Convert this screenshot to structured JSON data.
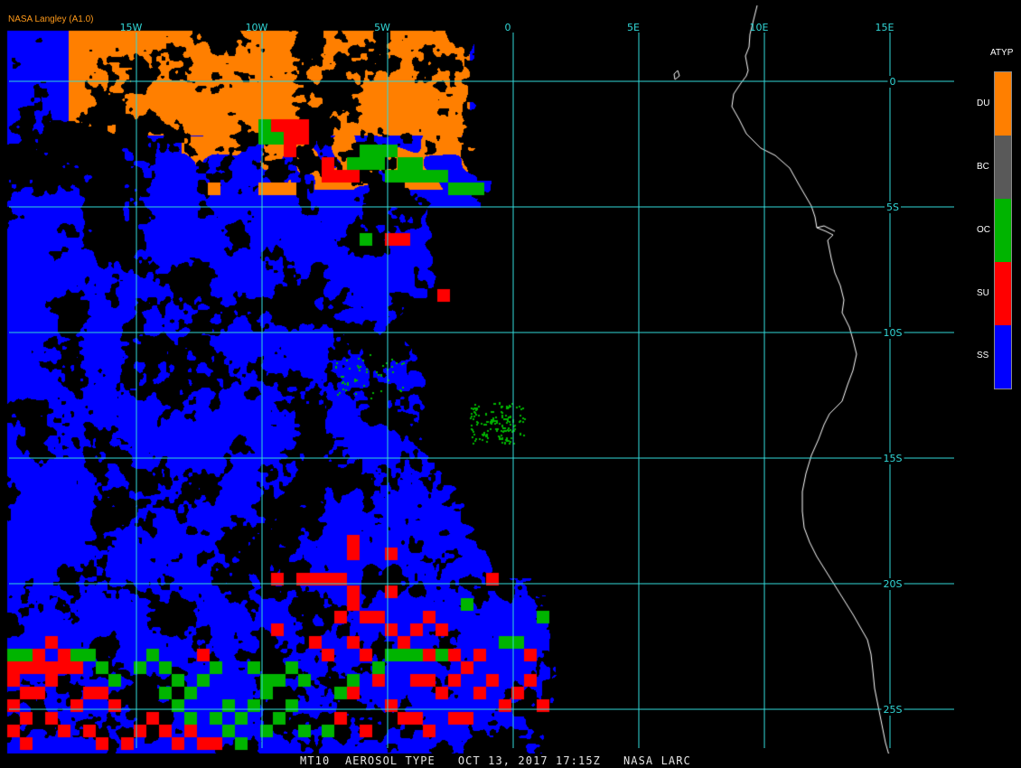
{
  "credit": "NASA Langley (A1.0)",
  "footer": "MT10  AEROSOL TYPE   OCT 13, 2017 17:15Z   NASA LARC",
  "legend": {
    "title": "ATYP",
    "items": [
      {
        "label": "DU",
        "color": "#ff7f00"
      },
      {
        "label": "BC",
        "color": "#595959"
      },
      {
        "label": "OC",
        "color": "#00b400"
      },
      {
        "label": "SU",
        "color": "#ff0000"
      },
      {
        "label": "SS",
        "color": "#0000ff"
      }
    ]
  },
  "grid": {
    "longitudes": [
      {
        "label": "15W",
        "value": -15
      },
      {
        "label": "10W",
        "value": -10
      },
      {
        "label": "5W",
        "value": -5
      },
      {
        "label": "0",
        "value": 0
      },
      {
        "label": "5E",
        "value": 5
      },
      {
        "label": "10E",
        "value": 10
      },
      {
        "label": "15E",
        "value": 15
      }
    ],
    "latitudes": [
      {
        "label": "0",
        "value": 0
      },
      {
        "label": "5S",
        "value": -5
      },
      {
        "label": "10S",
        "value": -10
      },
      {
        "label": "15S",
        "value": -15
      },
      {
        "label": "20S",
        "value": -20
      },
      {
        "label": "25S",
        "value": -25
      }
    ],
    "color": "#32d7d7"
  }
}
